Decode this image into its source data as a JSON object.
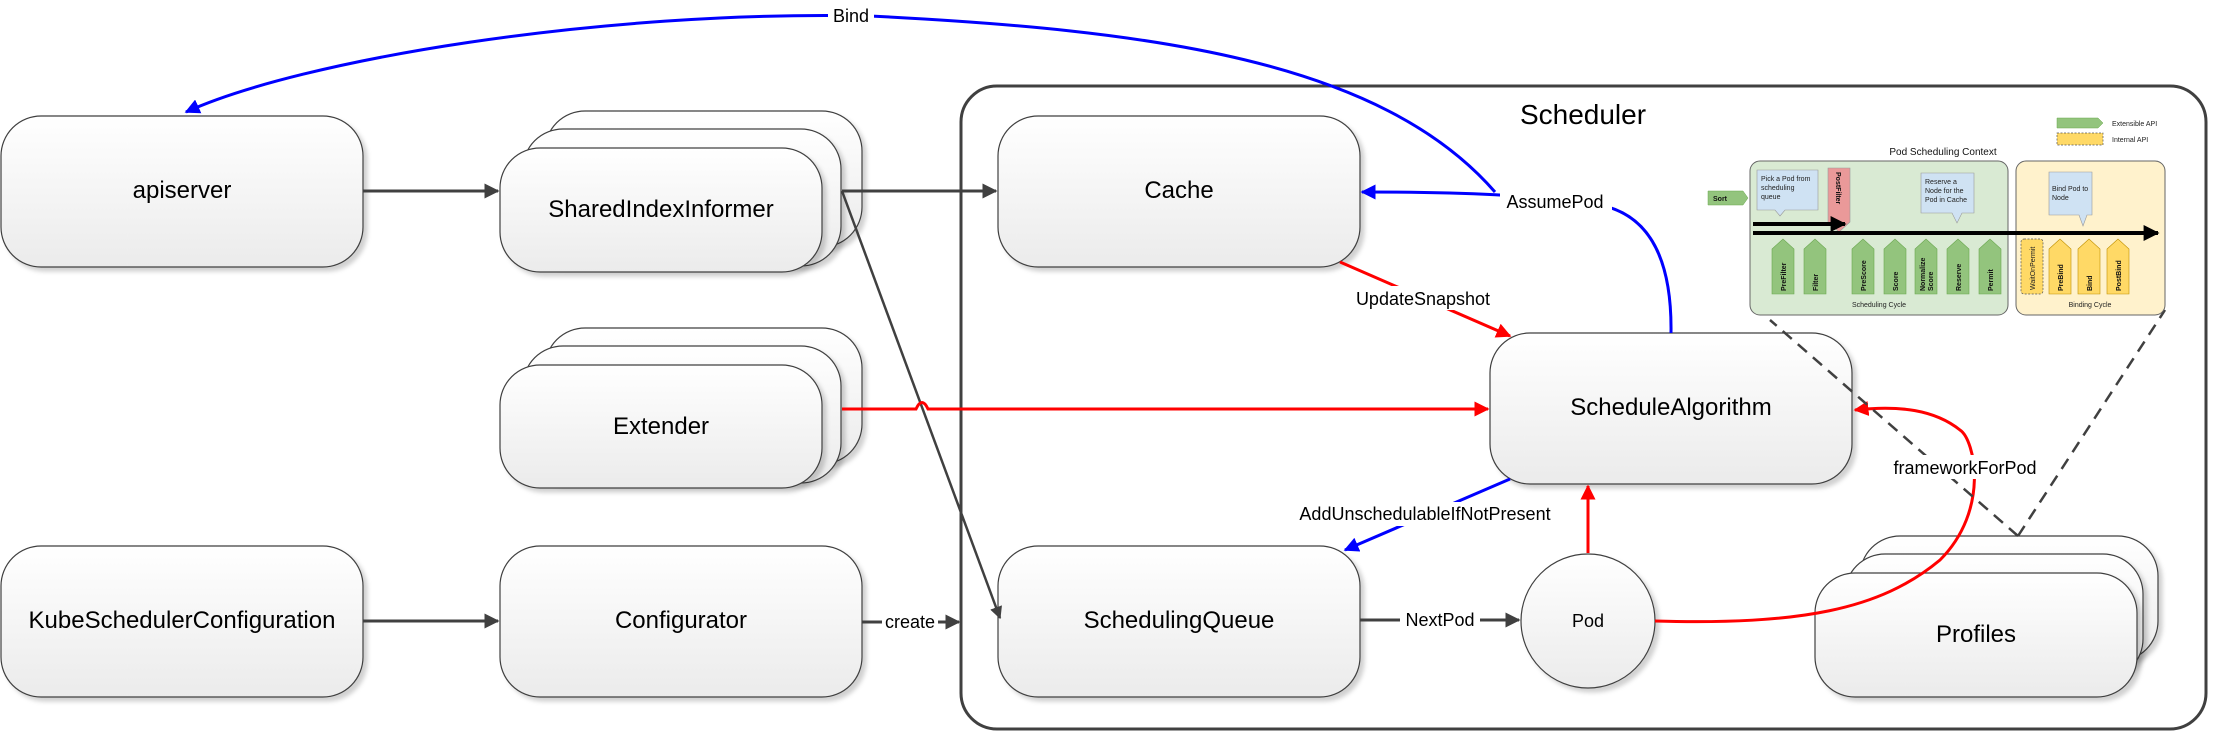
{
  "colors": {
    "edge_dark": "#404040",
    "edge_red": "#ff0000",
    "edge_blue": "#0000ff",
    "node_fill_top": "#ffffff",
    "node_fill_bottom": "#ececec",
    "inset_green": "#d9ead3",
    "inset_yellow": "#fff2cc",
    "plugin_green": "#93c47d",
    "plugin_yellow": "#ffd966",
    "plugin_red": "#ea9999",
    "callout_blue": "#cfe2f3"
  },
  "container": {
    "title": "Scheduler"
  },
  "nodes": {
    "apiserver": "apiserver",
    "shared_index_informer": "SharedIndexInformer",
    "extender": "Extender",
    "kube_scheduler_configuration": "KubeSchedulerConfiguration",
    "configurator": "Configurator",
    "cache": "Cache",
    "schedule_algorithm": "ScheduleAlgorithm",
    "scheduling_queue": "SchedulingQueue",
    "pod": "Pod",
    "profiles": "Profiles"
  },
  "edges": {
    "bind": "Bind",
    "assume_pod": "AssumePod",
    "update_snapshot": "UpdateSnapshot",
    "add_unschedulable": "AddUnschedulableIfNotPresent",
    "next_pod": "NextPod",
    "framework_for_pod": "frameworkForPod",
    "create": "create"
  },
  "inset": {
    "title": "Pod Scheduling Context",
    "legend": {
      "extensible": "Extensible API",
      "internal": "Internal API"
    },
    "sort": "Sort",
    "scheduling_cycle": {
      "label": "Scheduling Cycle",
      "callout_pick": [
        "Pick a Pod from",
        "scheduling",
        "queue"
      ],
      "callout_reserve": [
        "Reserve a",
        "Node for the",
        "Pod in Cache"
      ],
      "post_filter": "PostFilter",
      "plugins": [
        "PreFilter",
        "Filter",
        "PreScore",
        "Score",
        "Normalize Score",
        "Reserve",
        "Permit"
      ]
    },
    "binding_cycle": {
      "label": "Binding Cycle",
      "callout_bind": [
        "Bind Pod to",
        "Node"
      ],
      "wait_on_permit": "WaitOnPermit",
      "plugins": [
        "PreBind",
        "Bind",
        "PostBind"
      ]
    }
  }
}
